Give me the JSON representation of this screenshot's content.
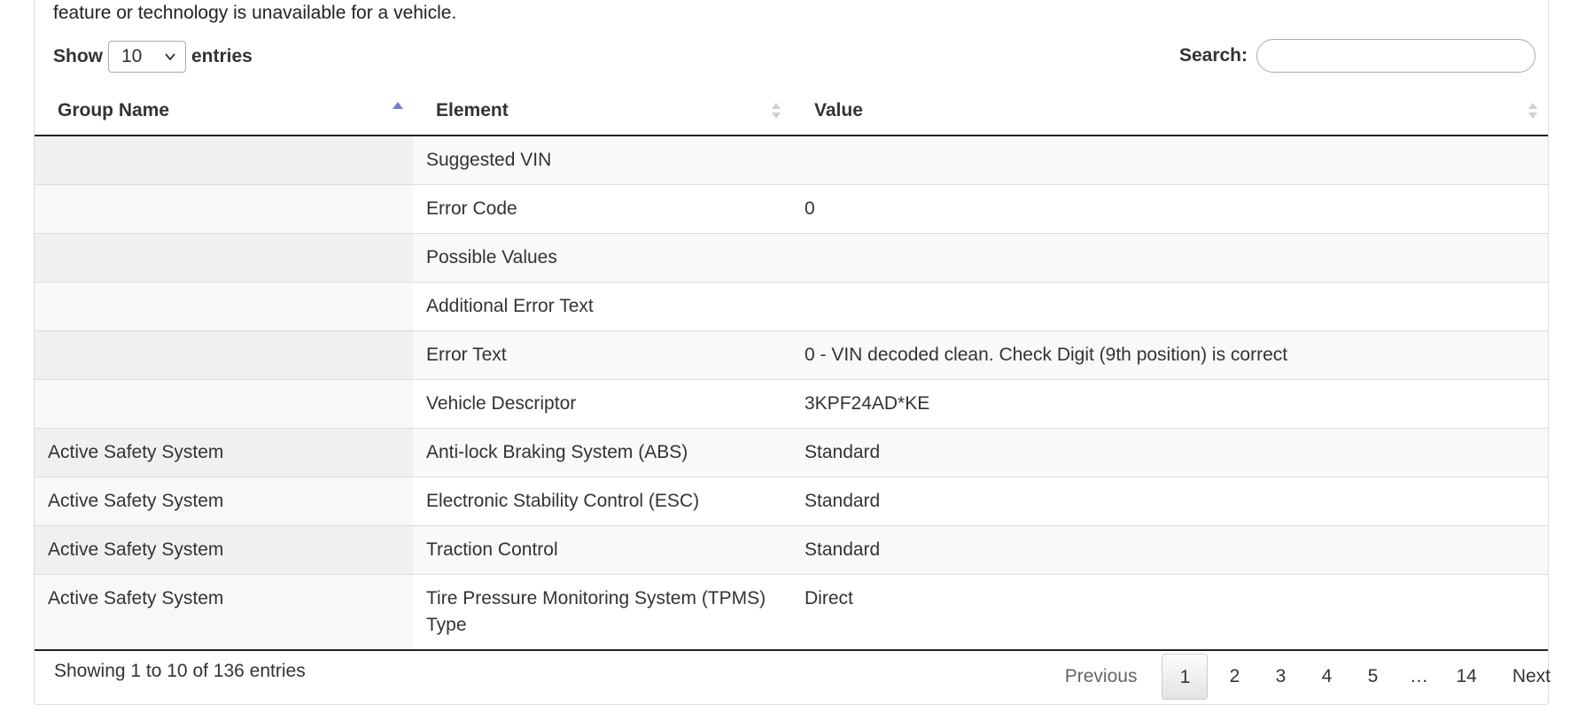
{
  "intro_text": "feature or technology is unavailable for a vehicle.",
  "length_menu": {
    "prefix": "Show",
    "selected": "10",
    "suffix": "entries"
  },
  "search": {
    "label": "Search:",
    "value": ""
  },
  "columns": [
    {
      "label": "Group Name",
      "sort": "asc"
    },
    {
      "label": "Element",
      "sort": "both"
    },
    {
      "label": "Value",
      "sort": "both"
    }
  ],
  "rows": [
    [
      "",
      "Suggested VIN",
      ""
    ],
    [
      "",
      "Error Code",
      "0"
    ],
    [
      "",
      "Possible Values",
      ""
    ],
    [
      "",
      "Additional Error Text",
      ""
    ],
    [
      "",
      "Error Text",
      "0 - VIN decoded clean. Check Digit (9th position) is correct"
    ],
    [
      "",
      "Vehicle Descriptor",
      "3KPF24AD*KE"
    ],
    [
      "Active Safety System",
      "Anti-lock Braking System (ABS)",
      "Standard"
    ],
    [
      "Active Safety System",
      "Electronic Stability Control (ESC)",
      "Standard"
    ],
    [
      "Active Safety System",
      "Traction Control",
      "Standard"
    ],
    [
      "Active Safety System",
      "Tire Pressure Monitoring System (TPMS) Type",
      "Direct"
    ]
  ],
  "footer": {
    "info": "Showing 1 to 10 of 136 entries",
    "previous": "Previous",
    "pages": [
      "1",
      "2",
      "3",
      "4",
      "5"
    ],
    "ellipsis": "…",
    "last_page": "14",
    "next": "Next",
    "current_page": "1"
  },
  "colors": {
    "sort_active": "#7b7bd3",
    "sort_inactive": "#d0d0d0"
  }
}
